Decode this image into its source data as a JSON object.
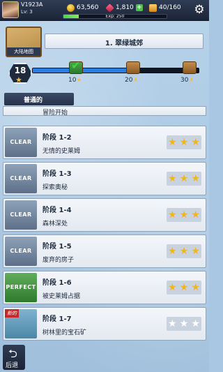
{
  "player": {
    "name": "V1923A",
    "level": "Lv: 3"
  },
  "resources": {
    "coins": "63,560",
    "gems": "1,810",
    "tickets": "40/160"
  },
  "exp": {
    "text": "Exp: 250"
  },
  "region": {
    "map_label": "大陆地图",
    "title": "1. 翠绿城郊"
  },
  "progress": {
    "current_stars": "18",
    "milestones": [
      "10",
      "20",
      "30"
    ]
  },
  "category": {
    "label": "普通的"
  },
  "partial_stage": {
    "name": "冒险开始"
  },
  "stages": [
    {
      "code": "阶段 1-2",
      "name": "无情的史莱姆",
      "badge": "CLEAR",
      "stars": 3
    },
    {
      "code": "阶段 1-3",
      "name": "探索奥秘",
      "badge": "CLEAR",
      "stars": 3
    },
    {
      "code": "阶段 1-4",
      "name": "森林深处",
      "badge": "CLEAR",
      "stars": 3
    },
    {
      "code": "阶段 1-5",
      "name": "废弃的房子",
      "badge": "CLEAR",
      "stars": 3
    },
    {
      "code": "阶段 1-6",
      "name": "被史莱姆占据",
      "badge": "PERFECT",
      "stars": 3
    },
    {
      "code": "阶段 1-7",
      "name": "树林里的宝石矿",
      "badge": "",
      "tag": "新的",
      "stars": 0
    }
  ],
  "back": {
    "label": "后退"
  },
  "icons": {
    "settings": "gear-icon",
    "back": "back-arrow-icon",
    "star": "star-icon"
  }
}
